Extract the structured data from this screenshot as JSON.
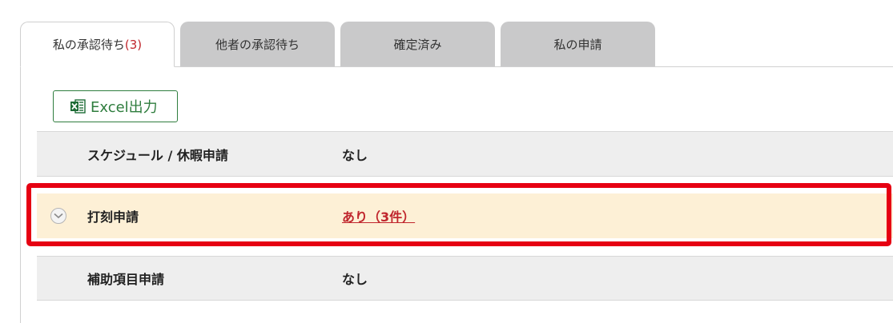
{
  "tabs": [
    {
      "label": "私の承認待ち",
      "count": "(3)"
    },
    {
      "label": "他者の承認待ち"
    },
    {
      "label": "確定済み"
    },
    {
      "label": "私の申請"
    }
  ],
  "toolbar": {
    "excel_label": "Excel出力"
  },
  "rows": [
    {
      "label": "スケジュール / 休暇申請",
      "value": "なし"
    },
    {
      "label": "打刻申請",
      "value": "あり（3件）"
    },
    {
      "label": "補助項目申請",
      "value": "なし"
    }
  ],
  "colors": {
    "accent_red": "#c0262d",
    "excel_green": "#2f7d3e",
    "highlight_bg": "#fdf0d6",
    "callout_border": "#e60012"
  }
}
